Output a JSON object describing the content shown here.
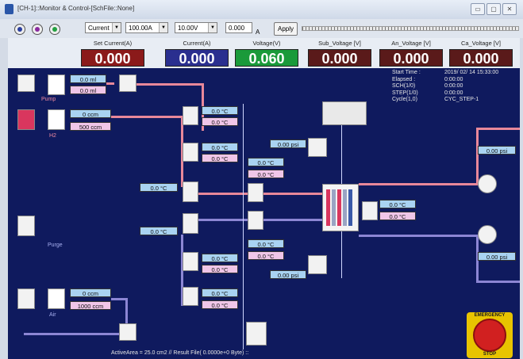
{
  "window": {
    "title": "[CH-1]::Monitor & Control-[SchFile::None]",
    "buttons": [
      "▭",
      "▢",
      "✕"
    ]
  },
  "toolbar": {
    "radios": [
      {
        "color": "#2a3fa0"
      },
      {
        "color": "#8a2aa0"
      },
      {
        "color": "#22a040"
      }
    ],
    "mode": "Current",
    "current_range": "100.00A",
    "voltage_range": "10.00V",
    "value": "0.000",
    "value_unit": "A",
    "apply_label": "Apply"
  },
  "meters": [
    {
      "label": "Set Current(A)",
      "value": "0.000",
      "color": "#8b1a1a"
    },
    {
      "label": "Current(A)",
      "value": "0.000",
      "color": "#2a2f8f"
    },
    {
      "label": "Voltage(V)",
      "value": "0.060",
      "color": "#1a9a3a"
    },
    {
      "label": "Sub_Voltage [V]",
      "value": "0.000",
      "color": "#5a1a1a"
    },
    {
      "label": "An_Voltage [V]",
      "value": "0.000",
      "color": "#5a1a1a"
    },
    {
      "label": "Ca_Voltage [V]",
      "value": "0.000",
      "color": "#5a1a1a"
    }
  ],
  "info": {
    "labels": [
      "Start Time :",
      "Elapsed :",
      "SCH(1/0)",
      "STEP(1/0)",
      "Cycle(1,0)"
    ],
    "values": [
      "2019/ 02/ 14 15:33:00",
      "0:00:00",
      "0:00:00",
      "0:00:00",
      "CYC_STEP-1"
    ]
  },
  "inlets": {
    "pump": {
      "label": "Pump",
      "top": "0.0 ml",
      "bottom": "0.0 ml"
    },
    "h2": {
      "label": "H2",
      "top": "0 ccm",
      "bottom": "500 ccm"
    },
    "purge": {
      "label": "Purge"
    },
    "air": {
      "label": "Air",
      "top": "0 ccm",
      "bottom": "1000 ccm"
    }
  },
  "temps": {
    "t1a": "0.0 °C",
    "t1b": "0.0 °C",
    "t2a": "0.0 °C",
    "t2b": "0.0 °C",
    "t3a": "0.0 °C",
    "t3b": "0.0 °C",
    "t4a": "0.0 °C",
    "t4b": "0.0 °C",
    "t5a": "0.0 °C",
    "t5b": "0.0 °C",
    "t6a": "0.0 °C",
    "t6b": "0.0 °C",
    "t7a": "0.0 °C",
    "t7b": "0.0 °C",
    "heater1": "0.0 °C",
    "heater2": "0.0 °C"
  },
  "pressures": {
    "p1": "0.00 psi",
    "p2": "0.00 psi",
    "p3": "0.00 psi",
    "p4": "0.00 psi"
  },
  "status": "ActiveArea =  25.0 cm2 // Result File( 0.0000e+0 Byte) ::",
  "emergency": {
    "top": "EMERGENCY",
    "bottom": "STOP"
  }
}
